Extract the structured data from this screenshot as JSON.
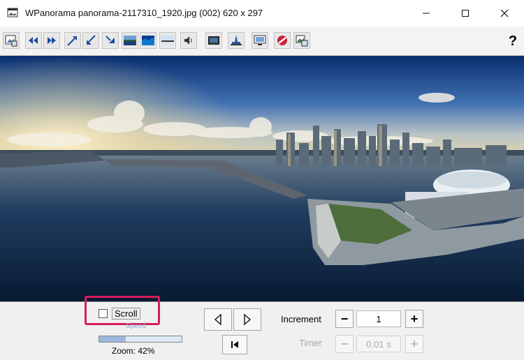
{
  "window": {
    "title": "WPanorama  panorama-2117310_1920.jpg   (002) 620 x 297",
    "icon": "panorama-app-icon",
    "controls": [
      "minimize-icon",
      "maximize-icon",
      "close-icon"
    ]
  },
  "toolbar": {
    "buttons": [
      {
        "icon": "open-image-icon",
        "highlighted": true
      },
      {
        "icon": "scroll-left-icon"
      },
      {
        "icon": "scroll-right-icon"
      },
      {
        "icon": "zoom-in-icon"
      },
      {
        "icon": "zoom-out-icon"
      },
      {
        "icon": "fit-icon"
      },
      {
        "icon": "landscape-icon"
      },
      {
        "icon": "seascape-icon"
      },
      {
        "icon": "horizon-icon"
      },
      {
        "icon": "sound-icon",
        "highlighted": true
      },
      {
        "icon": "screensaver-icon"
      },
      {
        "icon": "monument-icon"
      },
      {
        "icon": "monitor-icon"
      },
      {
        "icon": "no-entry-icon"
      },
      {
        "icon": "gallery-icon"
      }
    ],
    "help_label": "?"
  },
  "controls": {
    "scroll_label": "Scroll",
    "scroll_checked": false,
    "speed_label": "Speed",
    "zoom_label": "Zoom: 42%",
    "increment_label": "Increment",
    "increment_value": "1",
    "minus": "−",
    "plus": "+",
    "timer_label": "Timer",
    "timer_value": "0.01 s"
  },
  "colors": {
    "highlight": "#d81b5c",
    "sky_top": "#0a2f6e",
    "water": "#0c2440"
  }
}
